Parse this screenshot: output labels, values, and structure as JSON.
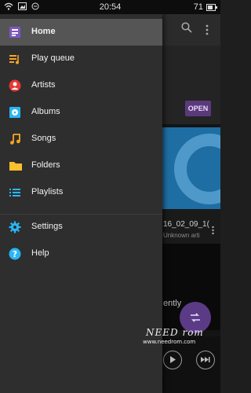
{
  "status_bar": {
    "time": "20:54",
    "battery": "71",
    "battery_level_percent": 71
  },
  "drawer": {
    "items": [
      {
        "label": "Home",
        "icon": "home-icon",
        "active": true
      },
      {
        "label": "Play queue",
        "icon": "play-queue-icon"
      },
      {
        "label": "Artists",
        "icon": "artists-icon"
      },
      {
        "label": "Albums",
        "icon": "albums-icon"
      },
      {
        "label": "Songs",
        "icon": "songs-icon"
      },
      {
        "label": "Folders",
        "icon": "folders-icon"
      },
      {
        "label": "Playlists",
        "icon": "playlists-icon"
      },
      {
        "label": "Settings",
        "icon": "settings-icon"
      },
      {
        "label": "Help",
        "icon": "help-icon"
      }
    ]
  },
  "background": {
    "open_label": "OPEN",
    "track_title": "16_02_09_1(",
    "track_artist": "Unknown arti",
    "recent_text": "ently"
  },
  "watermark": {
    "brand": "NEED rom",
    "url": "www.needrom.com"
  },
  "colors": {
    "drawer_bg": "#2e2e2e",
    "active_item": "#555555",
    "accent_purple": "#5b3b86",
    "banner_blue": "#1e6ea3"
  }
}
